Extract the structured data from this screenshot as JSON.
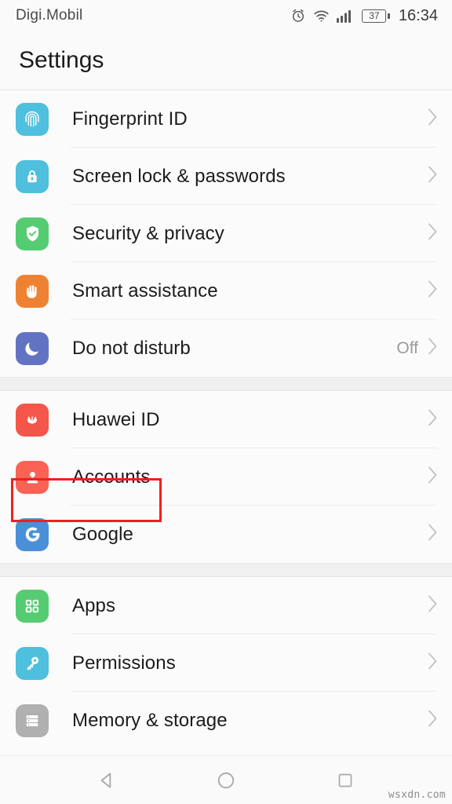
{
  "status_bar": {
    "carrier": "Digi.Mobil",
    "battery_level": "37",
    "time": "16:34",
    "icons": [
      "alarm-icon",
      "wifi-icon",
      "signal-icon",
      "battery-icon"
    ]
  },
  "header": {
    "title": "Settings"
  },
  "sections": [
    {
      "id": "security-section",
      "items": [
        {
          "label": "Fingerprint ID",
          "icon": "fingerprint-icon",
          "icon_color": "#4ebfdd",
          "value": ""
        },
        {
          "label": "Screen lock & passwords",
          "icon": "lock-icon",
          "icon_color": "#4ebfdd",
          "value": ""
        },
        {
          "label": "Security & privacy",
          "icon": "shield-check-icon",
          "icon_color": "#56cc72",
          "value": ""
        },
        {
          "label": "Smart assistance",
          "icon": "hand-icon",
          "icon_color": "#ef8232",
          "value": ""
        },
        {
          "label": "Do not disturb",
          "icon": "moon-icon",
          "icon_color": "#6373c4",
          "value": "Off"
        }
      ]
    },
    {
      "id": "accounts-section",
      "items": [
        {
          "label": "Huawei ID",
          "icon": "huawei-logo-icon",
          "icon_color": "#f4564a",
          "value": ""
        },
        {
          "label": "Accounts",
          "icon": "person-icon",
          "icon_color": "#fa6253",
          "value": ""
        },
        {
          "label": "Google",
          "icon": "google-g-icon",
          "icon_color": "#4a90d9",
          "value": ""
        }
      ]
    },
    {
      "id": "apps-section",
      "items": [
        {
          "label": "Apps",
          "icon": "grid-apps-icon",
          "icon_color": "#56cc72",
          "value": ""
        },
        {
          "label": "Permissions",
          "icon": "key-icon",
          "icon_color": "#4ebfdd",
          "value": ""
        },
        {
          "label": "Memory & storage",
          "icon": "storage-icon",
          "icon_color": "#b0b0b0",
          "value": ""
        }
      ]
    }
  ],
  "annotation": {
    "target_label": "Accounts",
    "color": "#ee2020"
  },
  "nav_bar": {
    "buttons": [
      "back-icon",
      "home-icon",
      "recents-icon"
    ]
  },
  "watermark": {
    "text": "wsxdn.com"
  }
}
